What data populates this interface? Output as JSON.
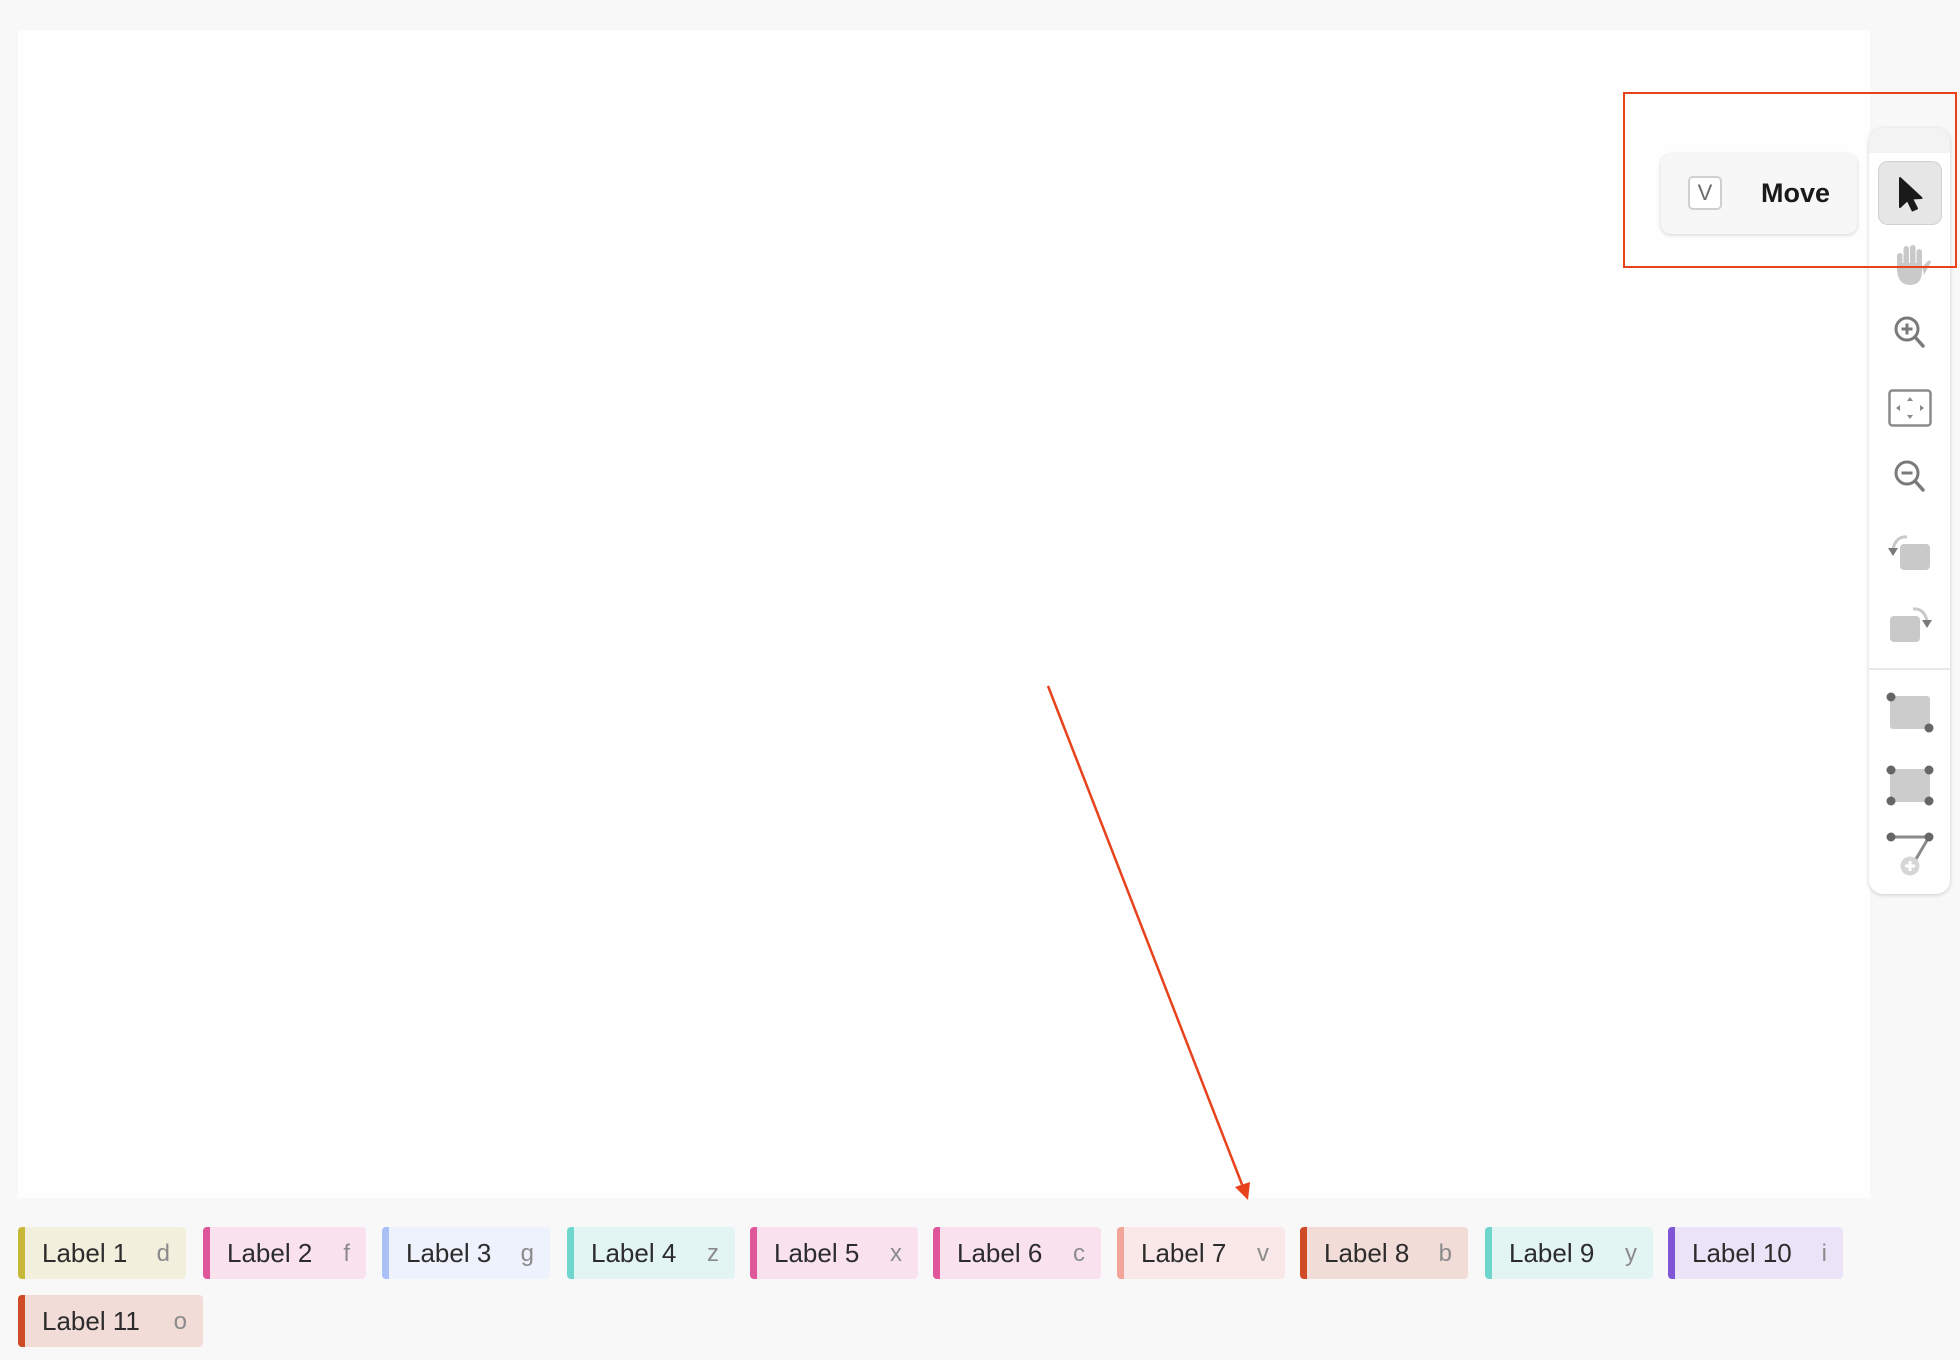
{
  "tooltip": {
    "shortcut": "V",
    "label": "Move"
  },
  "toolbar": {
    "tools": [
      {
        "name": "move",
        "icon": "cursor-arrow-icon",
        "active": true
      },
      {
        "name": "pan",
        "icon": "hand-icon",
        "active": false
      },
      {
        "name": "zoom-in",
        "icon": "zoom-in-icon",
        "active": false
      },
      {
        "name": "fit-to-screen",
        "icon": "fit-screen-icon",
        "active": false
      },
      {
        "name": "zoom-out",
        "icon": "zoom-out-icon",
        "active": false
      },
      {
        "name": "rotate-left",
        "icon": "rotate-left-icon",
        "active": false
      },
      {
        "name": "rotate-right",
        "icon": "rotate-right-icon",
        "active": false
      },
      {
        "name": "rectangle",
        "icon": "rectangle-two-point-icon",
        "active": false
      },
      {
        "name": "polygon",
        "icon": "rectangle-four-point-icon",
        "active": false
      },
      {
        "name": "add-keypoint",
        "icon": "keypoint-add-icon",
        "active": false
      }
    ]
  },
  "labels": [
    {
      "name": "Label 1",
      "key": "d",
      "color": "#c8b83a",
      "bg": "#f2efdc"
    },
    {
      "name": "Label 2",
      "key": "f",
      "color": "#e0569b",
      "bg": "#f9e2ee"
    },
    {
      "name": "Label 3",
      "key": "g",
      "color": "#a9c1f7",
      "bg": "#eef2fd"
    },
    {
      "name": "Label 4",
      "key": "z",
      "color": "#6ed6cc",
      "bg": "#e3f5f3"
    },
    {
      "name": "Label 5",
      "key": "x",
      "color": "#e0569b",
      "bg": "#f9e2ee"
    },
    {
      "name": "Label 6",
      "key": "c",
      "color": "#e0569b",
      "bg": "#f9e2ee"
    },
    {
      "name": "Label 7",
      "key": "v",
      "color": "#f3a59a",
      "bg": "#f9e8e7"
    },
    {
      "name": "Label 8",
      "key": "b",
      "color": "#cf4b25",
      "bg": "#f2dcd7"
    },
    {
      "name": "Label 9",
      "key": "y",
      "color": "#6ed6cc",
      "bg": "#e3f5f3"
    },
    {
      "name": "Label 10",
      "key": "i",
      "color": "#8055d6",
      "bg": "#ebe3f8"
    },
    {
      "name": "Label 11",
      "key": "o",
      "color": "#cf4b25",
      "bg": "#f2dcd7"
    }
  ],
  "colors": {
    "highlight": "#e8421c",
    "icon_dark": "#1a1a1a",
    "icon_gray": "#7a7a7a",
    "icon_light": "#c9c9c9"
  }
}
